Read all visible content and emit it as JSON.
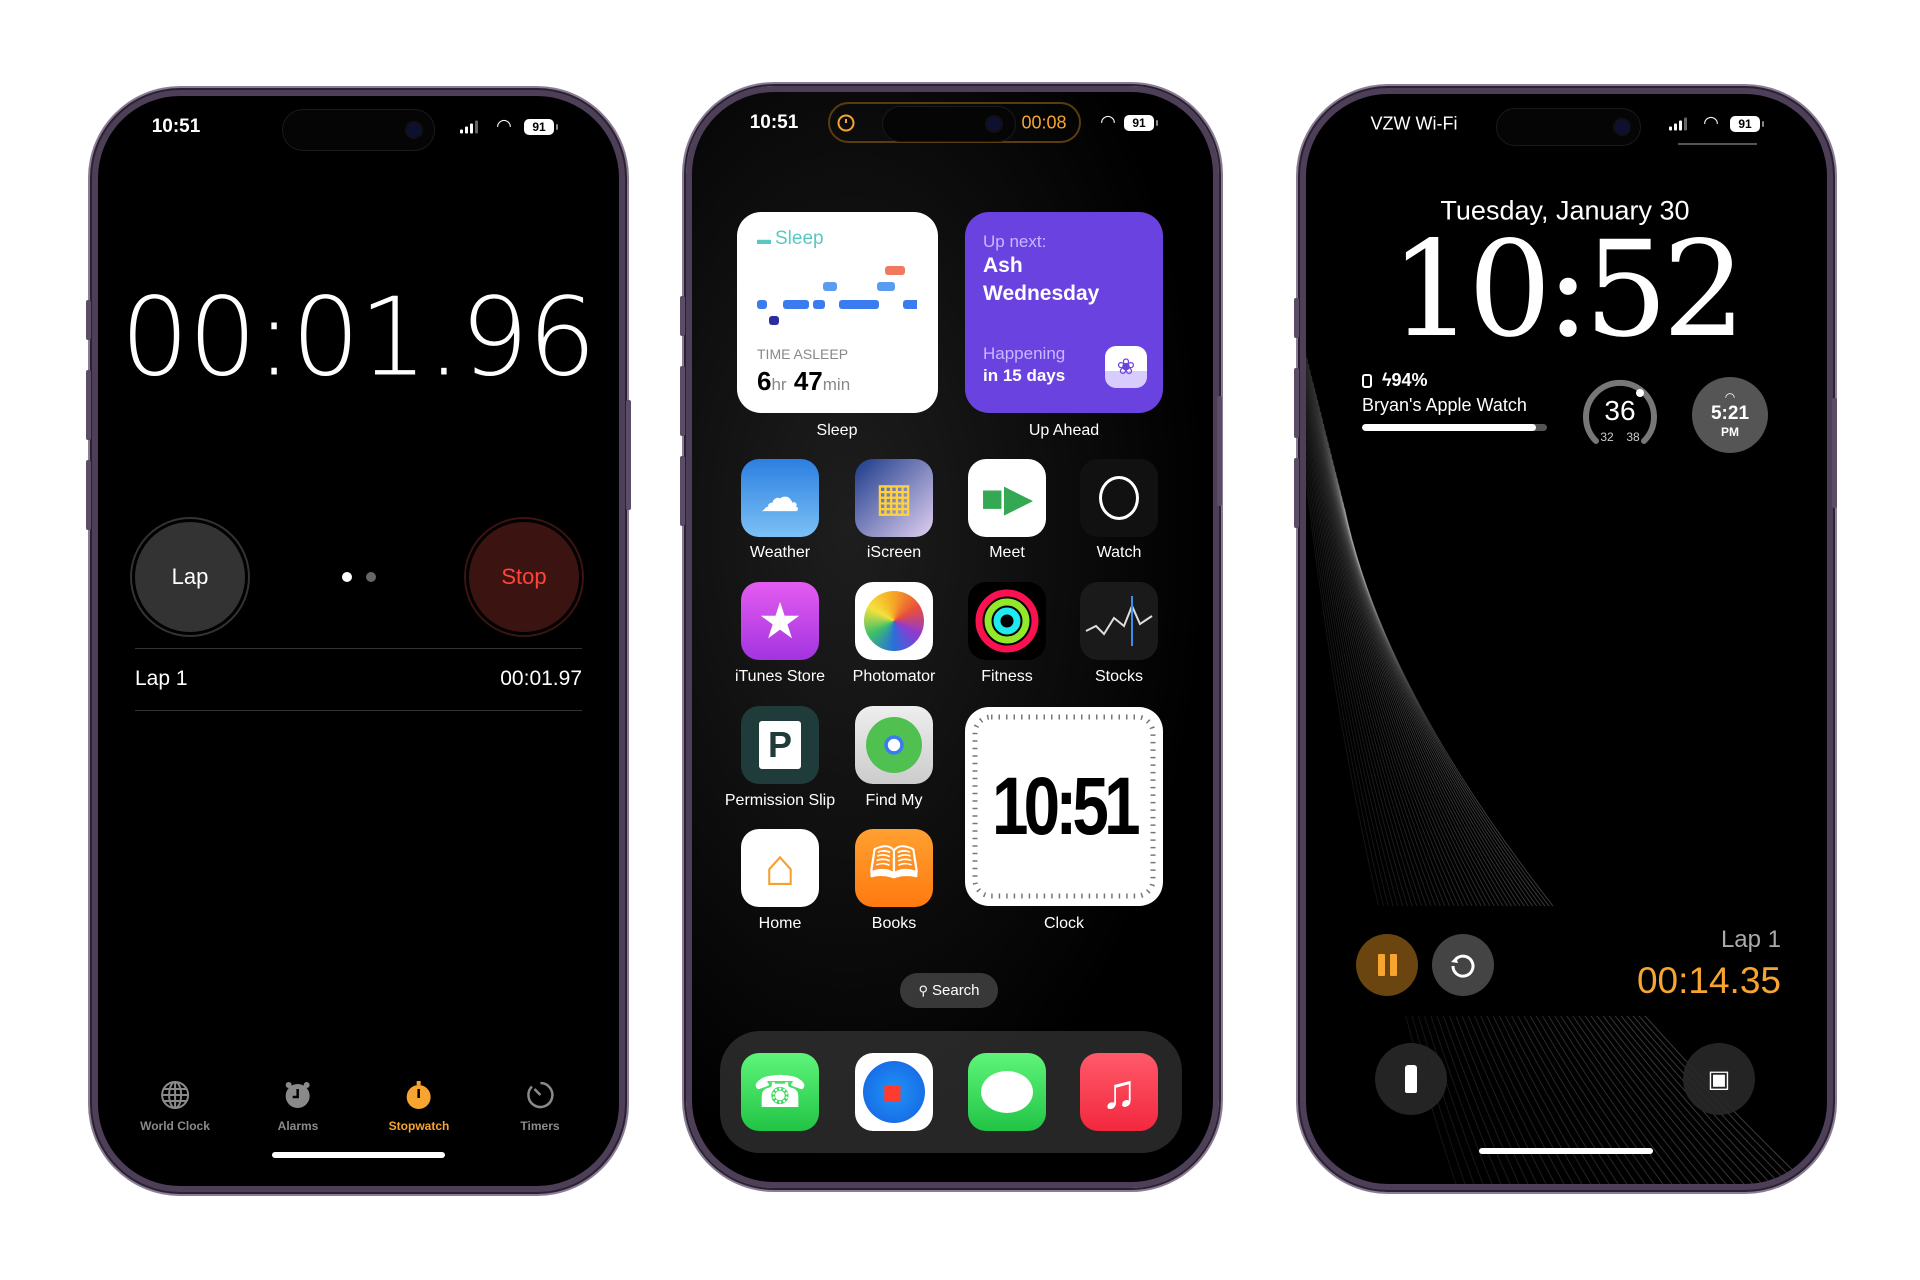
{
  "colors": {
    "accent_orange": "#f7a530",
    "stop_red": "#ff453a",
    "up_ahead_purple": "#6a42e0",
    "sleep_teal": "#5ac8c0",
    "frame": "#4d3f57"
  },
  "left_phone": {
    "status": {
      "time": "10:51",
      "battery": "91"
    },
    "stopwatch": {
      "time": "00:01.96",
      "lap_button": "Lap",
      "stop_button": "Stop",
      "page_indicator": {
        "count": 2,
        "active": 0
      },
      "laps": [
        {
          "label": "Lap 1",
          "time": "00:01.97"
        }
      ]
    },
    "tabs": [
      {
        "label": "World Clock",
        "icon": "globe-icon",
        "active": false
      },
      {
        "label": "Alarms",
        "icon": "alarm-clock-icon",
        "active": false
      },
      {
        "label": "Stopwatch",
        "icon": "stopwatch-icon",
        "active": true
      },
      {
        "label": "Timers",
        "icon": "timer-icon",
        "active": false
      }
    ]
  },
  "middle_phone": {
    "status": {
      "time": "10:51",
      "live_activity_time": "00:08",
      "battery": "91"
    },
    "sleep_widget": {
      "title": "Sleep",
      "caption": "TIME ASLEEP",
      "hours": "6",
      "hours_unit": "hr",
      "minutes": "47",
      "minutes_unit": "min",
      "label": "Sleep"
    },
    "up_ahead_widget": {
      "prefix": "Up next:",
      "event_line1": "Ash",
      "event_line2": "Wednesday",
      "when_line1": "Happening",
      "when_line2": "in 15 days",
      "label": "Up Ahead"
    },
    "apps": [
      {
        "label": "Weather",
        "icon": "weather-icon"
      },
      {
        "label": "iScreen",
        "icon": "iscreen-icon"
      },
      {
        "label": "Meet",
        "icon": "meet-icon"
      },
      {
        "label": "Watch",
        "icon": "watch-icon"
      },
      {
        "label": "iTunes Store",
        "icon": "star-icon"
      },
      {
        "label": "Photomator",
        "icon": "photomator-icon"
      },
      {
        "label": "Fitness",
        "icon": "fitness-rings-icon"
      },
      {
        "label": "Stocks",
        "icon": "stocks-icon"
      },
      {
        "label": "Permission Slip",
        "icon": "permission-slip-icon"
      },
      {
        "label": "Find My",
        "icon": "find-my-icon"
      },
      {
        "label": "Home",
        "icon": "home-icon"
      },
      {
        "label": "Books",
        "icon": "books-icon"
      }
    ],
    "clock_widget": {
      "time": "10:51",
      "label": "Clock"
    },
    "search": {
      "label": "Search"
    },
    "dock": [
      {
        "name": "Phone",
        "icon": "phone-icon"
      },
      {
        "name": "Safari",
        "icon": "safari-icon"
      },
      {
        "name": "Messages",
        "icon": "messages-icon"
      },
      {
        "name": "Music",
        "icon": "music-icon"
      }
    ]
  },
  "right_phone": {
    "status": {
      "carrier": "VZW Wi-Fi",
      "battery": "91"
    },
    "date": "Tuesday, January 30",
    "time": "10:52",
    "watch_widget": {
      "battery": "94%",
      "name": "Bryan's Apple Watch",
      "level_percent": 94
    },
    "weather_widget": {
      "temp": "36",
      "low": "32",
      "high": "38"
    },
    "sunset_widget": {
      "time": "5:21",
      "period": "PM"
    },
    "live_activity": {
      "lap": "Lap 1",
      "time": "00:14.35"
    }
  }
}
